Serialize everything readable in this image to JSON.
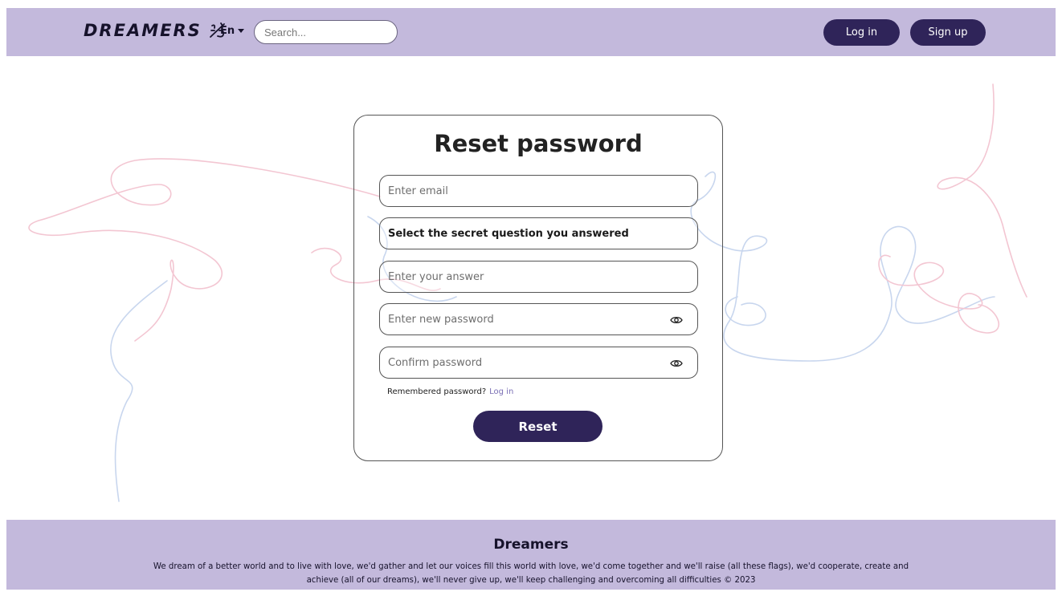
{
  "header": {
    "logo_text": "DREAMERS",
    "logo_icon": "sparkle-doodle-icon",
    "language": "En",
    "search_placeholder": "Search...",
    "login_label": "Log in",
    "signup_label": "Sign up"
  },
  "form": {
    "title": "Reset password",
    "email_placeholder": "Enter email",
    "secret_question_label": "Select the secret question you answered",
    "answer_placeholder": "Enter your answer",
    "new_password_placeholder": "Enter new password",
    "confirm_password_placeholder": "Confirm password",
    "eye_icon": "eye-icon",
    "remembered_text": "Remembered password?",
    "remembered_link": "Log in",
    "reset_label": "Reset"
  },
  "footer": {
    "title": "Dreamers",
    "text": "We dream of a better world and to live with love, we'd gather and let our voices fill this world with love, we'd come together and we'll raise (all these flags), we'd cooperate, create and achieve (all of our dreams), we'll never give up, we'll keep challenging and overcoming all difficulties © 2023"
  },
  "colors": {
    "brand_bar": "#c3b9dc",
    "button": "#2f2459",
    "link": "#7a6fb5",
    "deco_pink": "#f3c6d2",
    "deco_blue": "#c8d6ee"
  }
}
